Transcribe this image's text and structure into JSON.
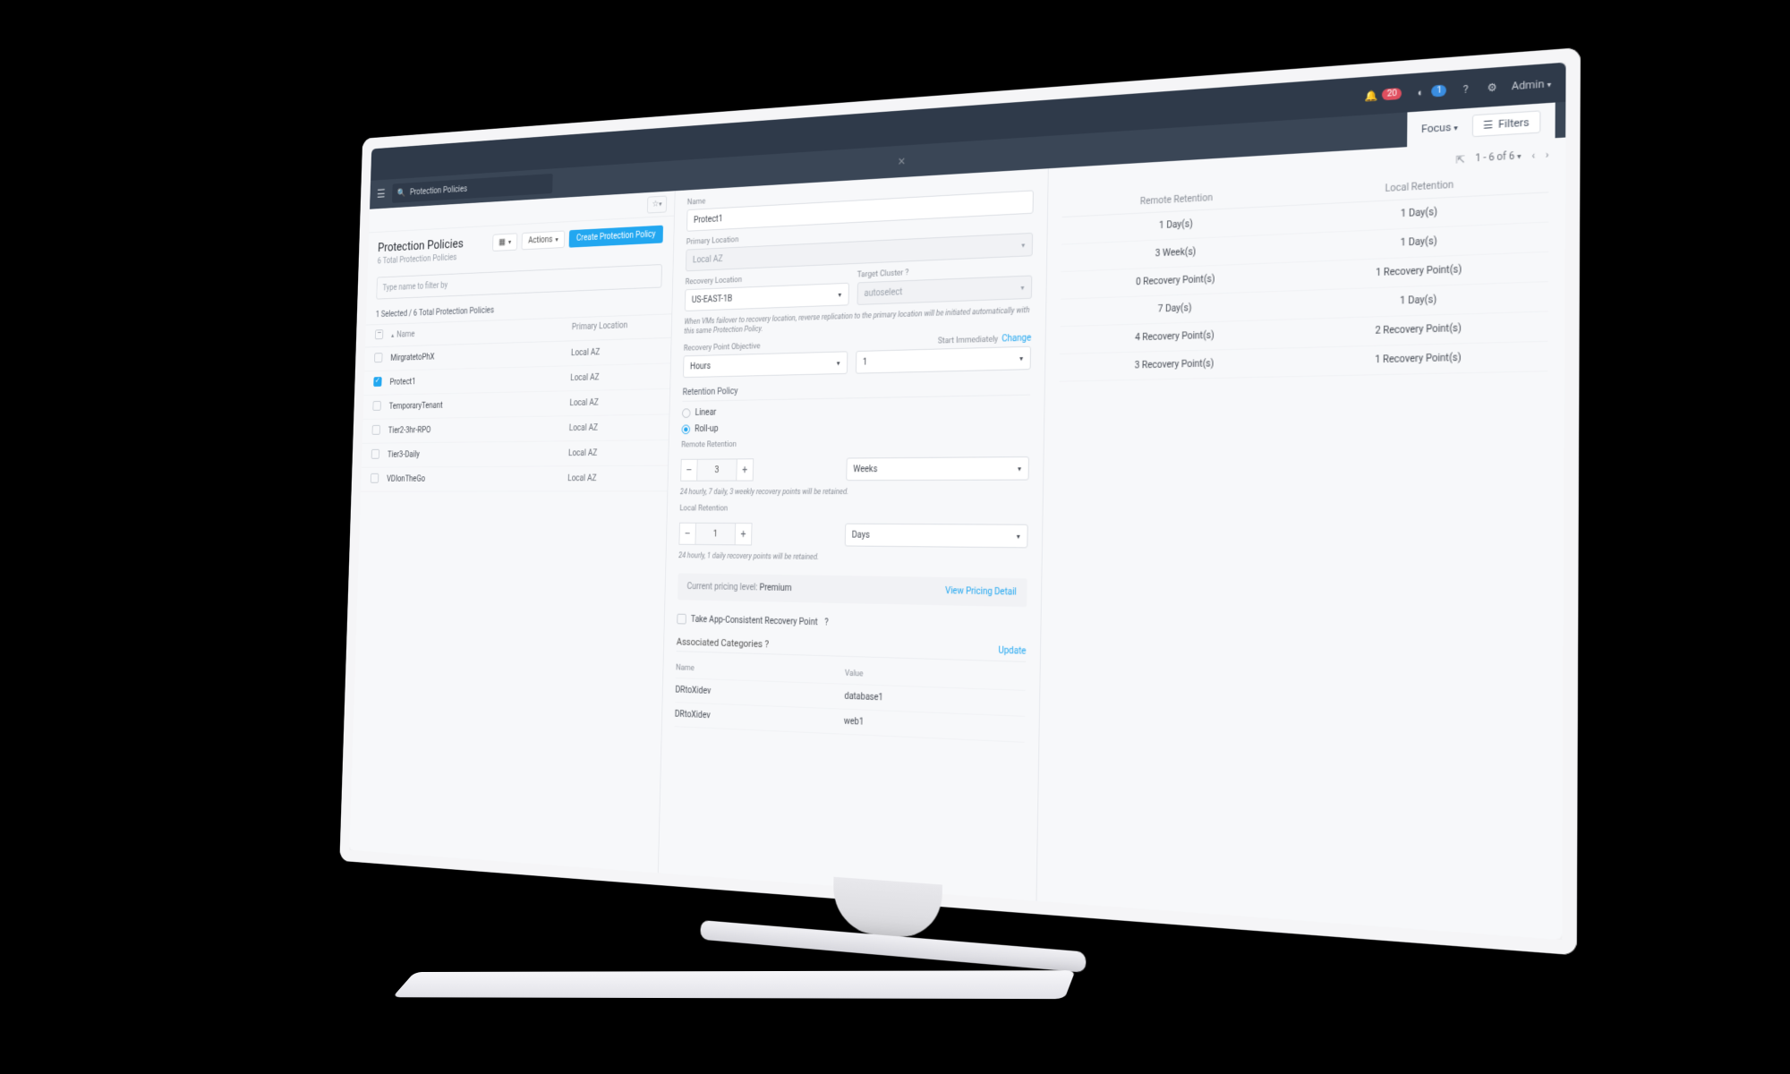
{
  "topbar": {
    "alert_count": "20",
    "task_count": "1",
    "user_label": "Admin"
  },
  "secondbar": {
    "breadcrumb": "Protection Policies",
    "focus_label": "Focus",
    "filters_label": "Filters"
  },
  "leftpane": {
    "title": "Protection Policies",
    "subtitle": "6 Total Protection Policies",
    "actions_label": "Actions",
    "create_label": "Create Protection Policy",
    "filter_placeholder": "Type name to filter by",
    "selected_text": "1 Selected / 6 Total Protection Policies",
    "col_name": "Name",
    "col_primary": "Primary Location",
    "rows": [
      {
        "name": "MirgratetoPhX",
        "loc": "Local AZ"
      },
      {
        "name": "Protect1",
        "loc": "Local AZ"
      },
      {
        "name": "TemporaryTenant",
        "loc": "Local AZ"
      },
      {
        "name": "Tier2-3hr-RPO",
        "loc": "Local AZ"
      },
      {
        "name": "Tier3-Daily",
        "loc": "Local AZ"
      },
      {
        "name": "VDIonTheGo",
        "loc": "Local AZ"
      }
    ]
  },
  "form": {
    "name_label": "Name",
    "name_value": "Protect1",
    "primary_loc_label": "Primary Location",
    "primary_loc_value": "Local AZ",
    "recovery_loc_label": "Recovery Location",
    "recovery_loc_value": "US-EAST-1B",
    "target_cluster_label": "Target Cluster",
    "target_cluster_value": "autoselect",
    "failover_note": "When VMs failover to recovery location, reverse replication to the primary location will be initiated automatically with this same Protection Policy.",
    "rpo_label": "Recovery Point Objective",
    "rpo_unit": "Hours",
    "rpo_value": "1",
    "start_label": "Start Immediately",
    "change_label": "Change",
    "retention_label": "Retention Policy",
    "retention_linear": "Linear",
    "retention_rollup": "Roll-up",
    "remote_ret_label": "Remote Retention",
    "remote_ret_val": "3",
    "remote_ret_unit": "Weeks",
    "remote_ret_note": "24 hourly, 7 daily, 3 weekly recovery points will be retained.",
    "local_ret_label": "Local Retention",
    "local_ret_val": "1",
    "local_ret_unit": "Days",
    "local_ret_note": "24 hourly, 1 daily recovery points will be retained.",
    "pricing_label": "Current pricing level:",
    "pricing_value": "Premium",
    "pricing_link": "View Pricing Detail",
    "app_consistent": "Take App-Consistent Recovery Point",
    "cat_heading": "Associated Categories",
    "cat_update": "Update",
    "cat_col_name": "Name",
    "cat_col_value": "Value",
    "cats": [
      {
        "n": "DRtoXidev",
        "v": "database1"
      },
      {
        "n": "DRtoXidev",
        "v": "web1"
      }
    ]
  },
  "right": {
    "range": "1 - 6 of 6",
    "col_remote": "Remote Retention",
    "col_local": "Local Retention",
    "rows": [
      {
        "r": "1 Day(s)",
        "l": "1 Day(s)"
      },
      {
        "r": "3 Week(s)",
        "l": "1 Day(s)"
      },
      {
        "r": "0 Recovery Point(s)",
        "l": "1 Recovery Point(s)"
      },
      {
        "r": "7 Day(s)",
        "l": "1 Day(s)"
      },
      {
        "r": "4 Recovery Point(s)",
        "l": "2 Recovery Point(s)"
      },
      {
        "r": "3 Recovery Point(s)",
        "l": "1 Recovery Point(s)"
      }
    ]
  }
}
